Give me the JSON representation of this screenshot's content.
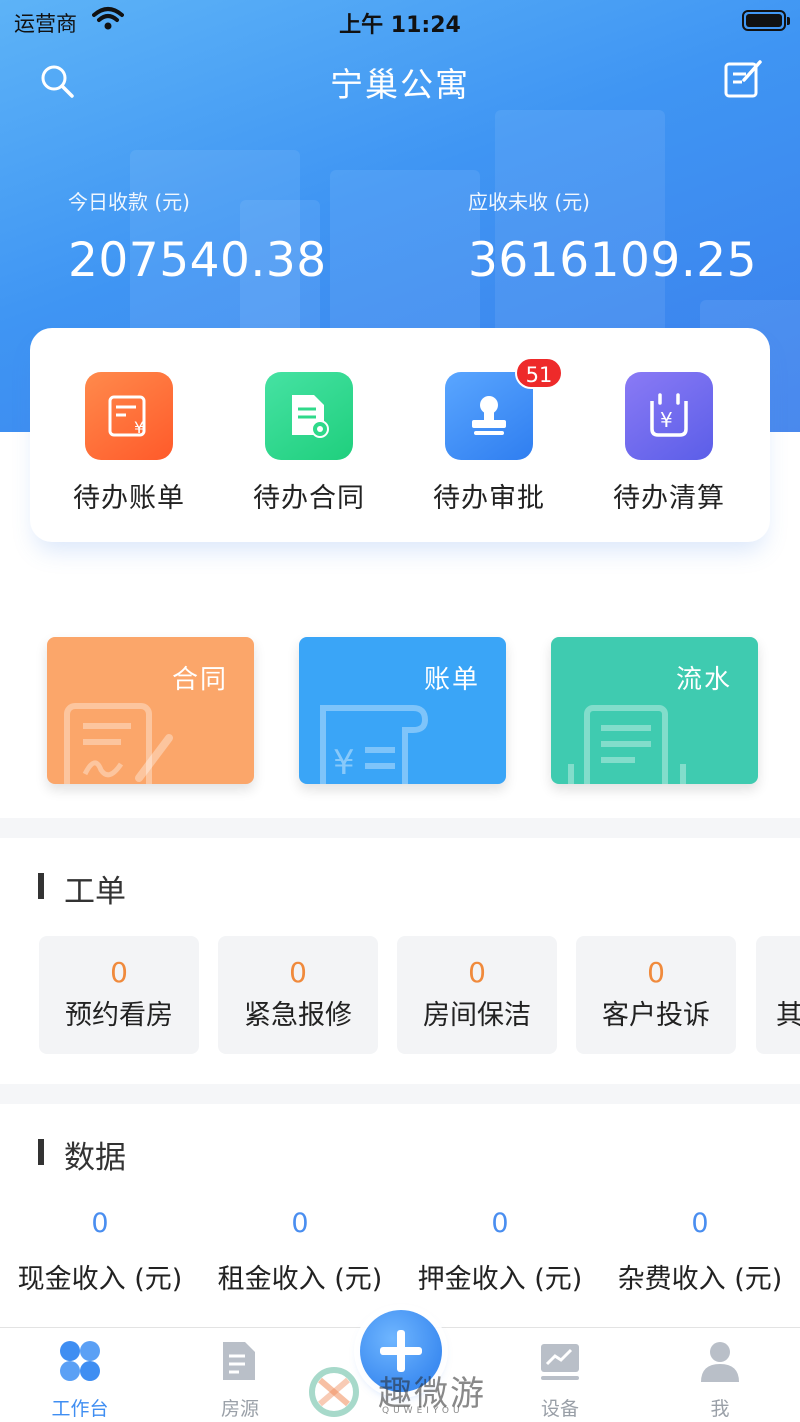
{
  "status_bar": {
    "carrier": "运营商",
    "time": "上午 11:24"
  },
  "nav": {
    "title": "宁巢公寓"
  },
  "stats": [
    {
      "label": "今日收款 (元)",
      "value": "207540.38"
    },
    {
      "label": "应收未收 (元)",
      "value": "3616109.25"
    }
  ],
  "todos": [
    {
      "label": "待办账单",
      "icon": "bill-icon",
      "color": "#ff6d3a"
    },
    {
      "label": "待办合同",
      "icon": "contract-icon",
      "color": "#2fd98a"
    },
    {
      "label": "待办审批",
      "icon": "stamp-icon",
      "color": "#3f8ef2",
      "badge": "51"
    },
    {
      "label": "待办清算",
      "icon": "settlement-icon",
      "color": "#7b67f0"
    }
  ],
  "tiles": [
    {
      "label": "合同",
      "color": "#fba66a"
    },
    {
      "label": "账单",
      "color": "#3aa5f7"
    },
    {
      "label": "流水",
      "color": "#3fcbb0"
    }
  ],
  "work_orders": {
    "title": "工单",
    "items": [
      {
        "count": "0",
        "label": "预约看房"
      },
      {
        "count": "0",
        "label": "紧急报修"
      },
      {
        "count": "0",
        "label": "房间保洁"
      },
      {
        "count": "0",
        "label": "客户投诉"
      },
      {
        "count": "",
        "label": "其"
      }
    ]
  },
  "data_section": {
    "title": "数据",
    "items": [
      {
        "value": "0",
        "label": "现金收入 (元)"
      },
      {
        "value": "0",
        "label": "租金收入 (元)"
      },
      {
        "value": "0",
        "label": "押金收入 (元)"
      },
      {
        "value": "0",
        "label": "杂费收入 (元)"
      }
    ]
  },
  "tabbar": {
    "tabs": [
      {
        "label": "工作台",
        "icon": "workbench-icon",
        "active": true
      },
      {
        "label": "房源",
        "icon": "listing-icon"
      },
      {
        "label": "设备",
        "icon": "device-icon"
      },
      {
        "label": "我",
        "icon": "profile-icon"
      }
    ]
  },
  "watermark": {
    "text": "趣微游",
    "sub": "QUWEIYOU"
  }
}
